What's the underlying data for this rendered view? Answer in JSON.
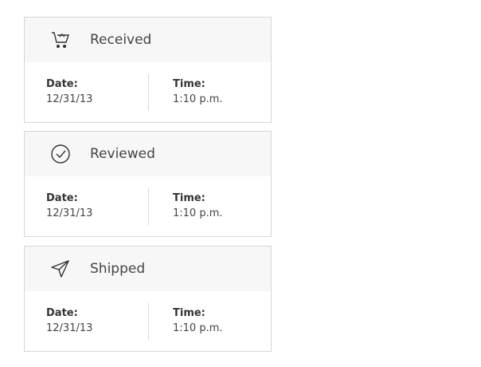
{
  "cards": [
    {
      "icon": "cart-icon",
      "title": "Received",
      "date_label": "Date:",
      "date": "12/31/13",
      "time_label": "Time:",
      "time": "1:10 p.m."
    },
    {
      "icon": "check-circle-icon",
      "title": "Reviewed",
      "date_label": "Date:",
      "date": "12/31/13",
      "time_label": "Time:",
      "time": "1:10 p.m."
    },
    {
      "icon": "paper-plane-icon",
      "title": "Shipped",
      "date_label": "Date:",
      "date": "12/31/13",
      "time_label": "Time:",
      "time": "1:10 p.m."
    }
  ]
}
